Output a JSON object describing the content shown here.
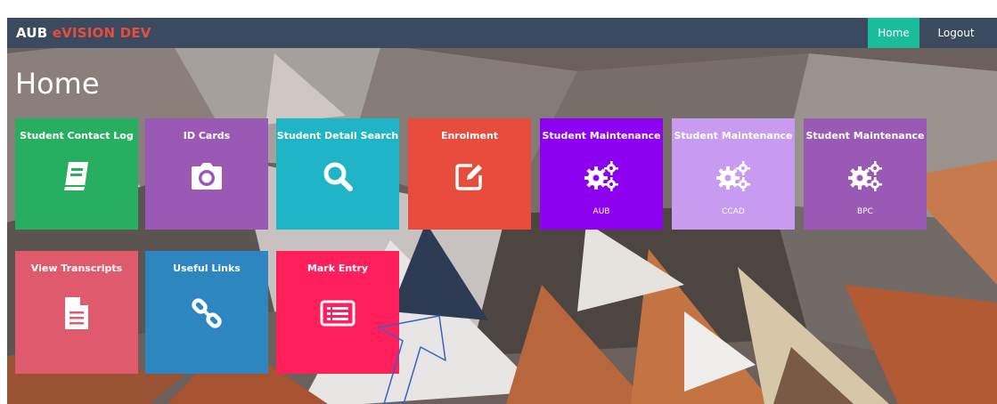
{
  "header": {
    "brand_primary": "AUB",
    "brand_accent": "eVISION DEV",
    "user_info": "",
    "date_info": "",
    "nav_home": "Home",
    "nav_logout": "Logout"
  },
  "page_title": "Home",
  "tiles": [
    {
      "label": "Student Contact Log",
      "icon": "book-icon",
      "sub": "",
      "color": "#27ae60"
    },
    {
      "label": "ID Cards",
      "icon": "camera-icon",
      "sub": "",
      "color": "#9b59b6"
    },
    {
      "label": "Student Detail Search",
      "icon": "search-icon",
      "sub": "",
      "color": "#1fb5c7"
    },
    {
      "label": "Enrolment",
      "icon": "edit-icon",
      "sub": "",
      "color": "#e74c3c"
    },
    {
      "label": "Student Maintenance",
      "icon": "gears-icon",
      "sub": "AUB",
      "color": "#8e00f0"
    },
    {
      "label": "Student Maintenance",
      "icon": "gears-icon",
      "sub": "CCAD",
      "color": "#c89bf0"
    },
    {
      "label": "Student Maintenance",
      "icon": "gears-icon",
      "sub": "BPC",
      "color": "#9b59b6"
    },
    {
      "label": "View Transcripts",
      "icon": "document-icon",
      "sub": "",
      "color": "#e05a6e"
    },
    {
      "label": "Useful Links",
      "icon": "link-icon",
      "sub": "",
      "color": "#2e86c1"
    },
    {
      "label": "Mark Entry",
      "icon": "list-card-icon",
      "sub": "",
      "color": "#ff1f5a"
    }
  ],
  "colors": {
    "topbar": "#3b4a5e",
    "accent_red": "#e84c3d",
    "nav_active": "#1abc9c",
    "annotation_arrow": "#3a62c4"
  }
}
